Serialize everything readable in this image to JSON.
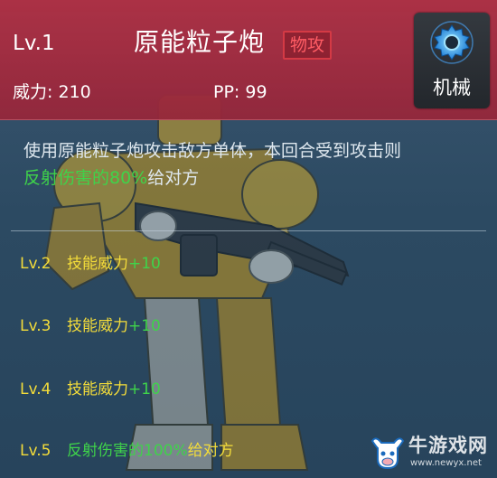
{
  "skill": {
    "level": "Lv.1",
    "name": "原能粒子炮",
    "category_tag": "物攻",
    "power_text": "威力: 210",
    "pp_text": "PP: 99",
    "type_icon": "gear-icon",
    "type_label": "机械"
  },
  "description": {
    "line1": "使用原能粒子炮攻击敌方单体，本回合受到攻击则",
    "line2_highlight": "反射伤害的80%",
    "line2_rest": "给对方"
  },
  "upgrades": [
    {
      "level": "Lv.2",
      "text": "技能威力",
      "bonus": "+10"
    },
    {
      "level": "Lv.3",
      "text": "技能威力",
      "bonus": "+10"
    },
    {
      "level": "Lv.4",
      "text": "技能威力",
      "bonus": "+10"
    },
    {
      "level": "Lv.5",
      "text": "反射伤害的100%",
      "bonus": "给对方"
    }
  ],
  "watermark": {
    "name": "牛游戏网",
    "url": "www.newyx.net",
    "logo_icon": "bull-logo"
  },
  "colors": {
    "header_red": "#b03044",
    "tag_red": "#ff5c64",
    "highlight_green": "#3fd34a",
    "upgrade_yellow": "#f3dc3a",
    "panel_blue": "#2c4a62"
  }
}
